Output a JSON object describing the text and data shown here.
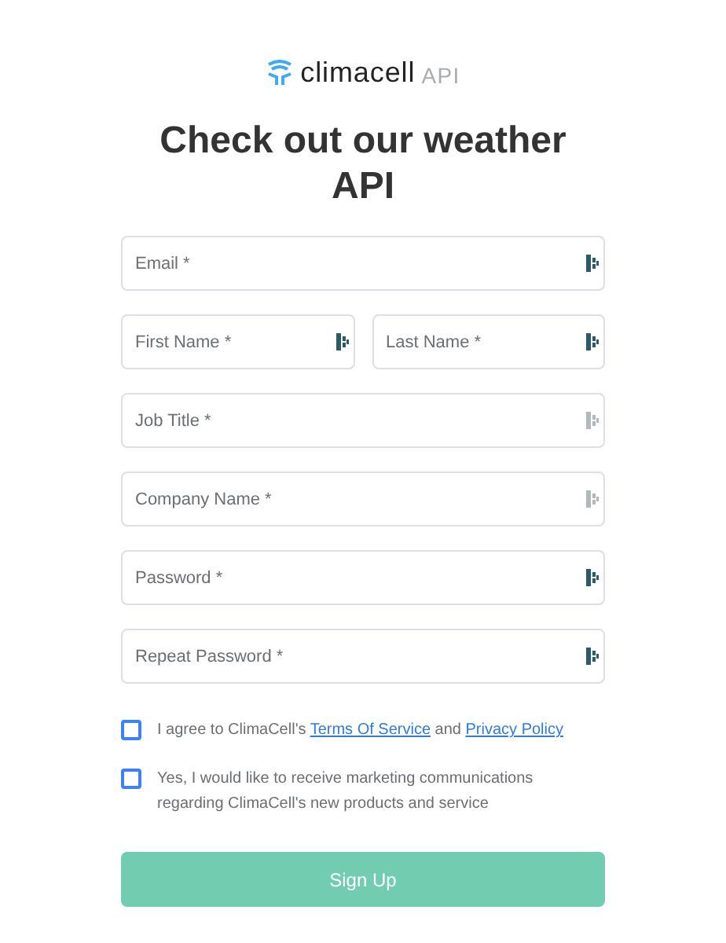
{
  "logo": {
    "brand": "climacell",
    "suffix": "API"
  },
  "title": "Check out our weather API",
  "rows": [
    [
      {
        "placeholder": "Email *",
        "icon_active": true
      }
    ],
    [
      {
        "placeholder": "First Name *",
        "icon_active": true
      },
      {
        "placeholder": "Last Name *",
        "icon_active": true
      }
    ],
    [
      {
        "placeholder": "Job Title *",
        "icon_active": false
      }
    ],
    [
      {
        "placeholder": "Company Name *",
        "icon_active": false
      }
    ],
    [
      {
        "placeholder": "Password *",
        "icon_active": true
      }
    ],
    [
      {
        "placeholder": "Repeat Password *",
        "icon_active": true
      }
    ]
  ],
  "consents": [
    {
      "checked": false,
      "segments": [
        {
          "kind": "text",
          "text": "I agree to ClimaCell's "
        },
        {
          "kind": "link",
          "text": "Terms Of Service"
        },
        {
          "kind": "text",
          "text": " and "
        },
        {
          "kind": "link",
          "text": "Privacy Policy"
        }
      ]
    },
    {
      "checked": false,
      "segments": [
        {
          "kind": "text",
          "text": "Yes, I would like to receive marketing communications regarding ClimaCell's new products and service"
        }
      ]
    }
  ],
  "submit": "Sign Up"
}
